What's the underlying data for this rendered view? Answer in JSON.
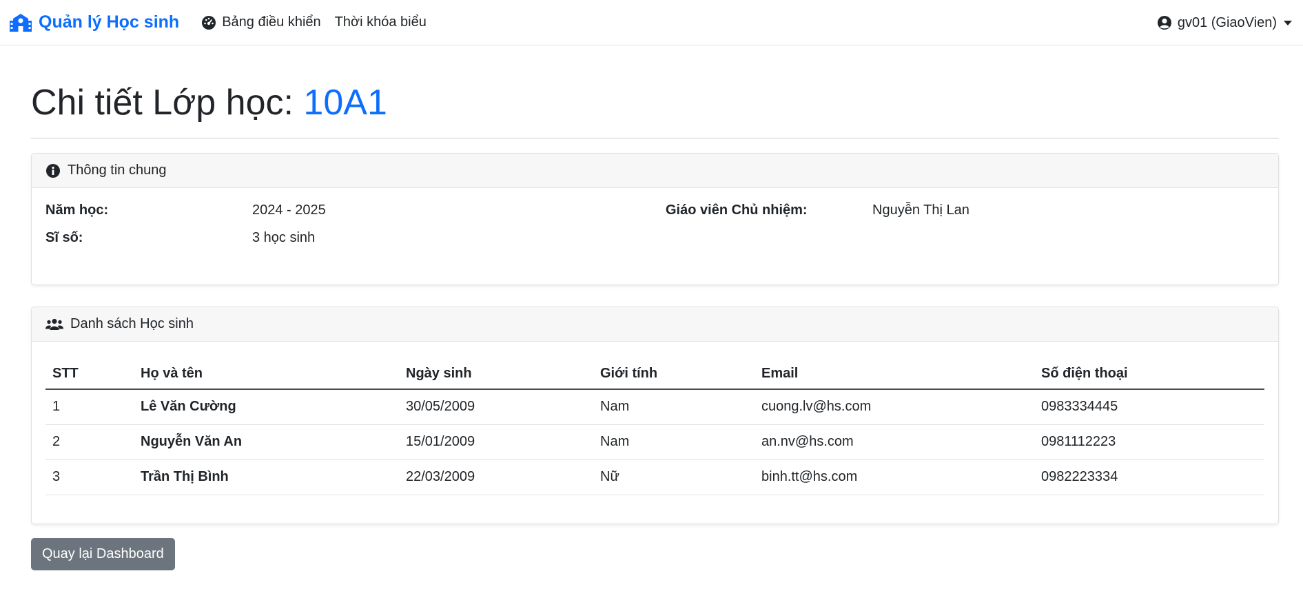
{
  "navbar": {
    "brand": "Quản lý Học sinh",
    "links": [
      {
        "label": "Bảng điều khiển",
        "icon": "dashboard-icon"
      },
      {
        "label": "Thời khóa biểu",
        "icon": ""
      }
    ],
    "user": "gv01 (GiaoVien)"
  },
  "page": {
    "title_prefix": "Chi tiết Lớp học: ",
    "class_name": "10A1"
  },
  "info_card": {
    "header": "Thông tin chung",
    "year_label": "Năm học:",
    "year_value": "2024 - 2025",
    "size_label": "Sĩ số:",
    "size_value": "3 học sinh",
    "teacher_label": "Giáo viên Chủ nhiệm:",
    "teacher_value": "Nguyễn Thị Lan"
  },
  "students_card": {
    "header": "Danh sách Học sinh",
    "columns": [
      "STT",
      "Họ và tên",
      "Ngày sinh",
      "Giới tính",
      "Email",
      "Số điện thoại"
    ],
    "rows": [
      [
        "1",
        "Lê Văn Cường",
        "30/05/2009",
        "Nam",
        "cuong.lv@hs.com",
        "0983334445"
      ],
      [
        "2",
        "Nguyễn Văn An",
        "15/01/2009",
        "Nam",
        "an.nv@hs.com",
        "0981112223"
      ],
      [
        "3",
        "Trần Thị Bình",
        "22/03/2009",
        "Nữ",
        "binh.tt@hs.com",
        "0982223334"
      ]
    ]
  },
  "back_button": "Quay lại Dashboard",
  "colors": {
    "accent": "#0d6efd",
    "button": "#6c757d"
  }
}
